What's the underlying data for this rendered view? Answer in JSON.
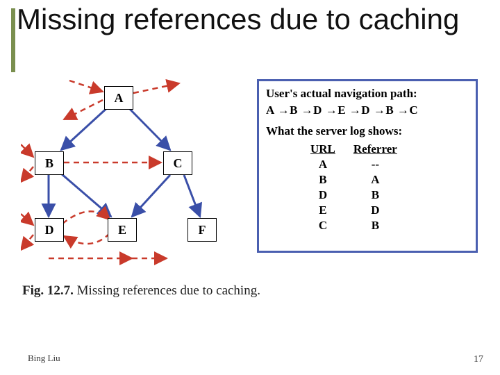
{
  "slide": {
    "title": "Missing references due to caching",
    "author": "Bing Liu",
    "page_number": "17"
  },
  "graph": {
    "nodes": {
      "A": "A",
      "B": "B",
      "C": "C",
      "D": "D",
      "E": "E",
      "F": "F"
    }
  },
  "panel": {
    "nav_header": "User's actual navigation path:",
    "nav_path": "A →B →D →E →D →B →C",
    "log_header": "What the server log shows:",
    "table_headers": {
      "url": "URL",
      "ref": "Referrer"
    },
    "log": [
      {
        "url": "A",
        "ref": "--"
      },
      {
        "url": "B",
        "ref": "A"
      },
      {
        "url": "D",
        "ref": "B"
      },
      {
        "url": "E",
        "ref": "D"
      },
      {
        "url": "C",
        "ref": "B"
      }
    ]
  },
  "caption": {
    "label": "Fig. 12.7.",
    "text": " Missing references due to caching."
  }
}
